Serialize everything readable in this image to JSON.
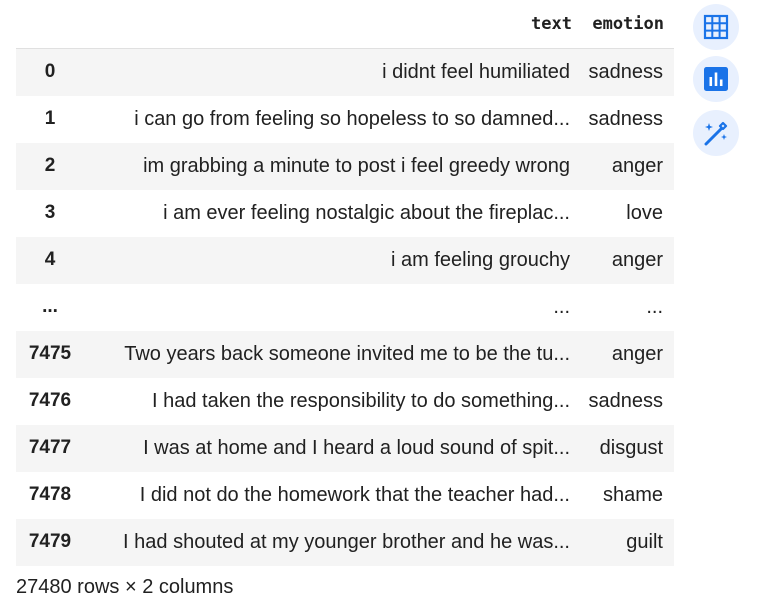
{
  "table": {
    "columns": [
      "text",
      "emotion"
    ],
    "rows": [
      {
        "index": "0",
        "text": "i didnt feel humiliated",
        "emotion": "sadness"
      },
      {
        "index": "1",
        "text": "i can go from feeling so hopeless to so damned...",
        "emotion": "sadness"
      },
      {
        "index": "2",
        "text": "im grabbing a minute to post i feel greedy wrong",
        "emotion": "anger"
      },
      {
        "index": "3",
        "text": "i am ever feeling nostalgic about the fireplac...",
        "emotion": "love"
      },
      {
        "index": "4",
        "text": "i am feeling grouchy",
        "emotion": "anger"
      },
      {
        "index": "...",
        "text": "...",
        "emotion": "..."
      },
      {
        "index": "7475",
        "text": "Two years back someone invited me to be the tu...",
        "emotion": "anger"
      },
      {
        "index": "7476",
        "text": "I had taken the responsibility to do something...",
        "emotion": "sadness"
      },
      {
        "index": "7477",
        "text": "I was at home and I heard a loud sound of spit...",
        "emotion": "disgust"
      },
      {
        "index": "7478",
        "text": "I did not do the homework that the teacher had...",
        "emotion": "shame"
      },
      {
        "index": "7479",
        "text": "I had shouted at my younger brother and he was...",
        "emotion": "guilt"
      }
    ]
  },
  "footer": "27480 rows × 2 columns",
  "side_buttons": [
    {
      "icon": "table-icon"
    },
    {
      "icon": "bar-chart-icon"
    },
    {
      "icon": "magic-wand-icon"
    }
  ],
  "colors": {
    "accent": "#1a73e8",
    "button_bg": "#e8f0fe",
    "row_stripe": "#f5f5f5"
  }
}
